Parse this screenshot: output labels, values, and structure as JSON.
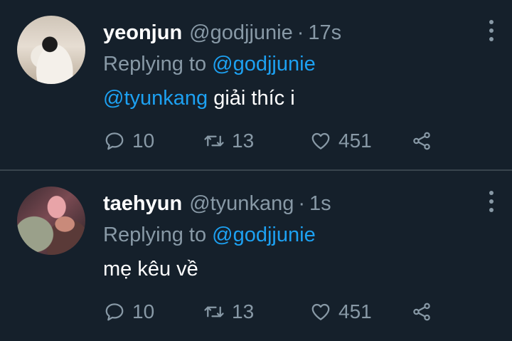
{
  "tweets": [
    {
      "name": "yeonjun",
      "handle": "@godjjunie",
      "separator": "·",
      "time": "17s",
      "replying_label": "Replying to",
      "replying_to": "@godjjunie",
      "mention": "@tyunkang",
      "text": "giải thíc i",
      "replies": "10",
      "retweets": "13",
      "likes": "451"
    },
    {
      "name": "taehyun",
      "handle": "@tyunkang",
      "separator": "·",
      "time": "1s",
      "replying_label": "Replying to",
      "replying_to": "@godjjunie",
      "text": "mẹ kêu về",
      "replies": "10",
      "retweets": "13",
      "likes": "451"
    }
  ],
  "icons": {
    "more": "more-vertical-icon",
    "reply": "reply-icon",
    "retweet": "retweet-icon",
    "like": "heart-icon",
    "share": "share-icon"
  },
  "colors": {
    "background": "#15202b",
    "text": "#ffffff",
    "muted": "#8899a6",
    "link": "#1da1f2",
    "divider": "#38444d"
  }
}
